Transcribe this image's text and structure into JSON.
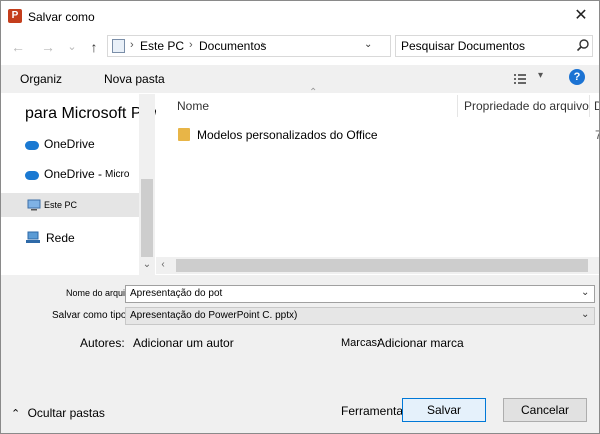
{
  "window": {
    "title": "Salvar como",
    "app_icon_letter": "P",
    "close_glyph": "✕"
  },
  "nav": {
    "back_glyph": "←",
    "forward_glyph": "→",
    "recent_glyph": "⌄",
    "up_glyph": "↑",
    "breadcrumb": [
      "Este PC",
      "Documentos"
    ],
    "separator_glyph": "›",
    "dropdown_glyph": "⌄",
    "refresh_glyph": "↻"
  },
  "search": {
    "placeholder": "Pesquisar Documentos"
  },
  "toolbar": {
    "organize_label": "Organiz",
    "new_folder_label": "Nova pasta",
    "view_dropdown_glyph": "▾",
    "help_glyph": "?"
  },
  "navpane": {
    "partial_text": "para Microsoft PowerPC",
    "items": [
      {
        "label": "OneDrive",
        "icon": "cloud-icon"
      },
      {
        "label": "OneDrive -",
        "suffix": "Micro",
        "icon": "cloud-icon"
      },
      {
        "label": "Este PC",
        "icon": "computer-icon",
        "selected": true
      },
      {
        "label": "Rede",
        "icon": "network-icon"
      }
    ],
    "scroll_down_glyph": "⌄"
  },
  "filelist": {
    "sort_indicator": "⌃",
    "columns": [
      "Nome",
      "Propriedade do arquivo",
      "D"
    ],
    "rows": [
      {
        "name": "Modelos personalizados do Office",
        "date_partial": "7"
      }
    ],
    "scroll_left_glyph": "‹"
  },
  "form": {
    "filename_label": "Nome do arquivo:",
    "filename_value": "Apresentação do pot",
    "filetype_label": "Salvar como tipo:",
    "filetype_value": "Apresentação do PowerPoint C. pptx)",
    "dropdown_glyph": "⌄",
    "authors_label": "Autores:",
    "authors_value": "Adicionar um autor",
    "tags_label": "Marcas:",
    "tags_value": "Adicionar marca"
  },
  "footer": {
    "hide_folders_glyph": "⌃",
    "hide_folders_label": "Ocultar pastas",
    "tools_label": "Ferramentas",
    "save_label": "Salvar",
    "cancel_label": "Cancelar"
  },
  "colors": {
    "accent": "#0078d7",
    "onedrive": "#1a79d2",
    "folder": "#e8b547",
    "powerpoint": "#c43e1c"
  }
}
